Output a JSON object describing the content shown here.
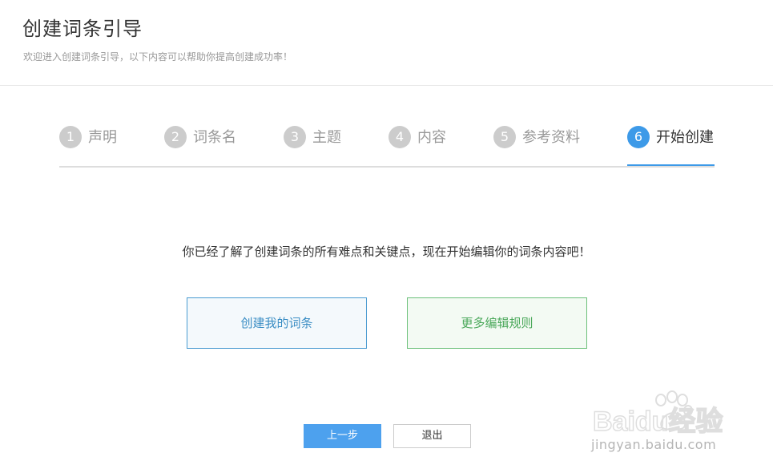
{
  "header": {
    "title": "创建词条引导",
    "subtitle": "欢迎进入创建词条引导，以下内容可以帮助你提高创建成功率！"
  },
  "steps": [
    {
      "num": "1",
      "label": "声明",
      "active": false
    },
    {
      "num": "2",
      "label": "词条名",
      "active": false
    },
    {
      "num": "3",
      "label": "主题",
      "active": false
    },
    {
      "num": "4",
      "label": "内容",
      "active": false
    },
    {
      "num": "5",
      "label": "参考资料",
      "active": false
    },
    {
      "num": "6",
      "label": "开始创建",
      "active": true
    }
  ],
  "main": {
    "message": "你已经了解了创建词条的所有难点和关键点，现在开始编辑你的词条内容吧！",
    "create_label": "创建我的词条",
    "rules_label": "更多编辑规则"
  },
  "footer": {
    "prev_label": "上一步",
    "exit_label": "退出"
  },
  "watermark": {
    "logo_text": "Baidu经验",
    "url_text": "jingyan.baidu.com"
  },
  "colors": {
    "accent": "#3d9ae8",
    "inactive_step": "#cccccc",
    "create_border": "#4a9bd1",
    "rules_border": "#6cc07a"
  }
}
